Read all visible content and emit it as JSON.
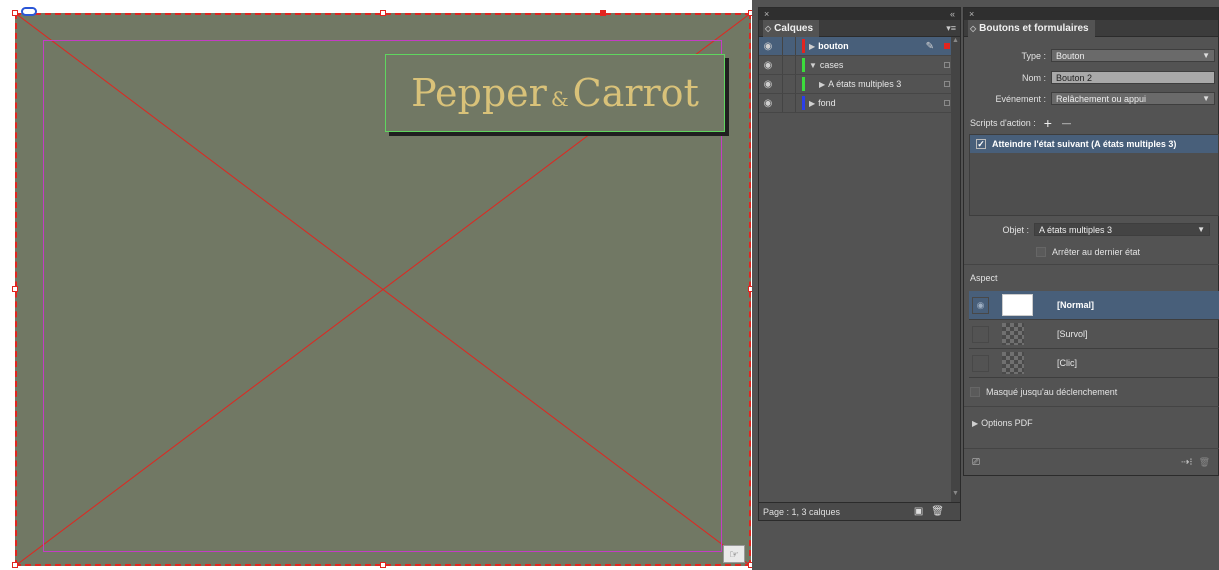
{
  "canvas": {
    "logo_word1": "Pepper",
    "logo_amp": "&",
    "logo_word2": "Carrot"
  },
  "layers_panel": {
    "close_symbol": "×",
    "collapse_symbol": "«",
    "title": "Calques",
    "menu_icon": "menu-icon",
    "layers": [
      {
        "name": "bouton",
        "color": "#e2251f",
        "selected": true,
        "expanded": false
      },
      {
        "name": "cases",
        "color": "#3cdc3c",
        "selected": false,
        "expanded": true
      },
      {
        "name": "A états multiples 3",
        "color": "#3cdc3c",
        "selected": false,
        "expanded": false,
        "child": true
      },
      {
        "name": "fond",
        "color": "#2b3fe8",
        "selected": false,
        "expanded": false
      }
    ],
    "layer_names": {
      "l0": "bouton",
      "l1": "cases",
      "l2": "A états multiples 3",
      "l3": "fond"
    },
    "footer_text": "Page : 1, 3 calques"
  },
  "buttons_panel": {
    "close_symbol": "×",
    "title": "Boutons et formulaires",
    "type_label": "Type :",
    "type_value": "Bouton",
    "name_label": "Nom :",
    "name_value": "Bouton 2",
    "event_label": "Evénement :",
    "event_value": "Relâchement ou appui",
    "scripts_label": "Scripts d'action :",
    "add_symbol": "+",
    "remove_symbol": "—",
    "script_item": "Atteindre l'état suivant (A états multiples 3)",
    "object_label": "Objet :",
    "object_value": "A états multiples 3",
    "stop_last_label": "Arrêter au dernier état",
    "aspect_label": "Aspect",
    "states": [
      "[Normal]",
      "[Survol]",
      "[Clic]"
    ],
    "hidden_until_label": "Masqué jusqu'au déclenchement",
    "pdf_options_label": "Options PDF"
  }
}
